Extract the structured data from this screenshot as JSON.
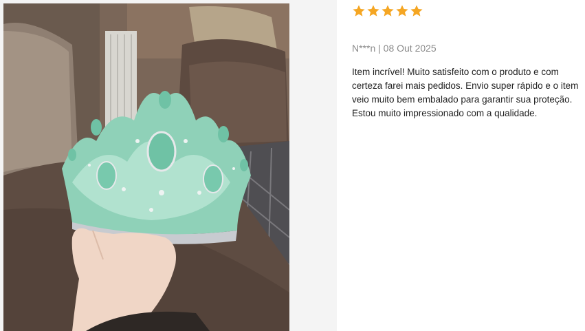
{
  "review": {
    "rating": 5,
    "max_rating": 5,
    "star_color": "#f5a623",
    "author": "N***n",
    "separator": "|",
    "date": "08 Out 2025",
    "meta_line": "N***n | 08 Out 2025",
    "text": "Item incrível! Muito satisfeito com o produto e com certeza farei mais pedidos. Envio super rápido e o item veio muito bem embalado para garantir sua proteção. Estou muito impressionado com a qualidade."
  },
  "photo": {
    "subject": "hand holding a crystal tiara with mint-green stones",
    "icon": "review-photo"
  }
}
